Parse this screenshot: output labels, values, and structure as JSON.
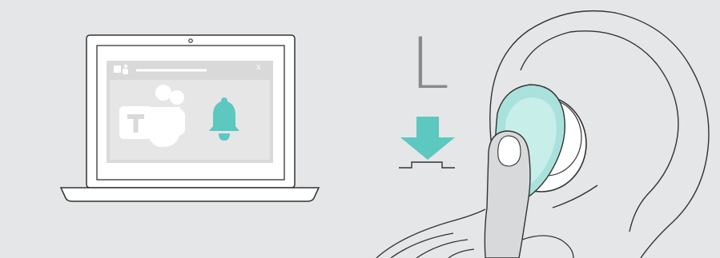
{
  "side_label": "L",
  "dialog_close": "x",
  "colors": {
    "background": "#e5e6e7",
    "accent": "#5cc8c0",
    "accent_light": "#a9e2dd",
    "line": "#333333",
    "screen_gray": "#d9d9da"
  },
  "icons": [
    "laptop-icon",
    "teams-logo-icon",
    "bell-icon",
    "press-down-arrow-icon",
    "button-icon",
    "earbud-icon",
    "ear-icon",
    "finger-icon"
  ]
}
